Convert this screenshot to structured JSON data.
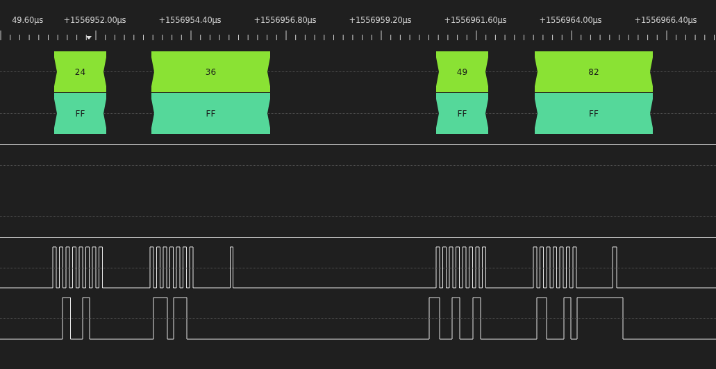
{
  "ruler": {
    "labels": [
      "49.60µs",
      "+1556952.00µs",
      "+1556954.40µs",
      "+1556956.80µs",
      "+1556959.20µs",
      "+1556961.60µs",
      "+1556964.00µs",
      "+1556966.40µs"
    ]
  },
  "decoder": {
    "rows": [
      {
        "color": "#8ae234",
        "bytes": [
          "24",
          "36",
          "49",
          "82"
        ]
      },
      {
        "color": "#55d89a",
        "bytes": [
          "FF",
          "FF",
          "FF",
          "FF"
        ]
      }
    ]
  }
}
